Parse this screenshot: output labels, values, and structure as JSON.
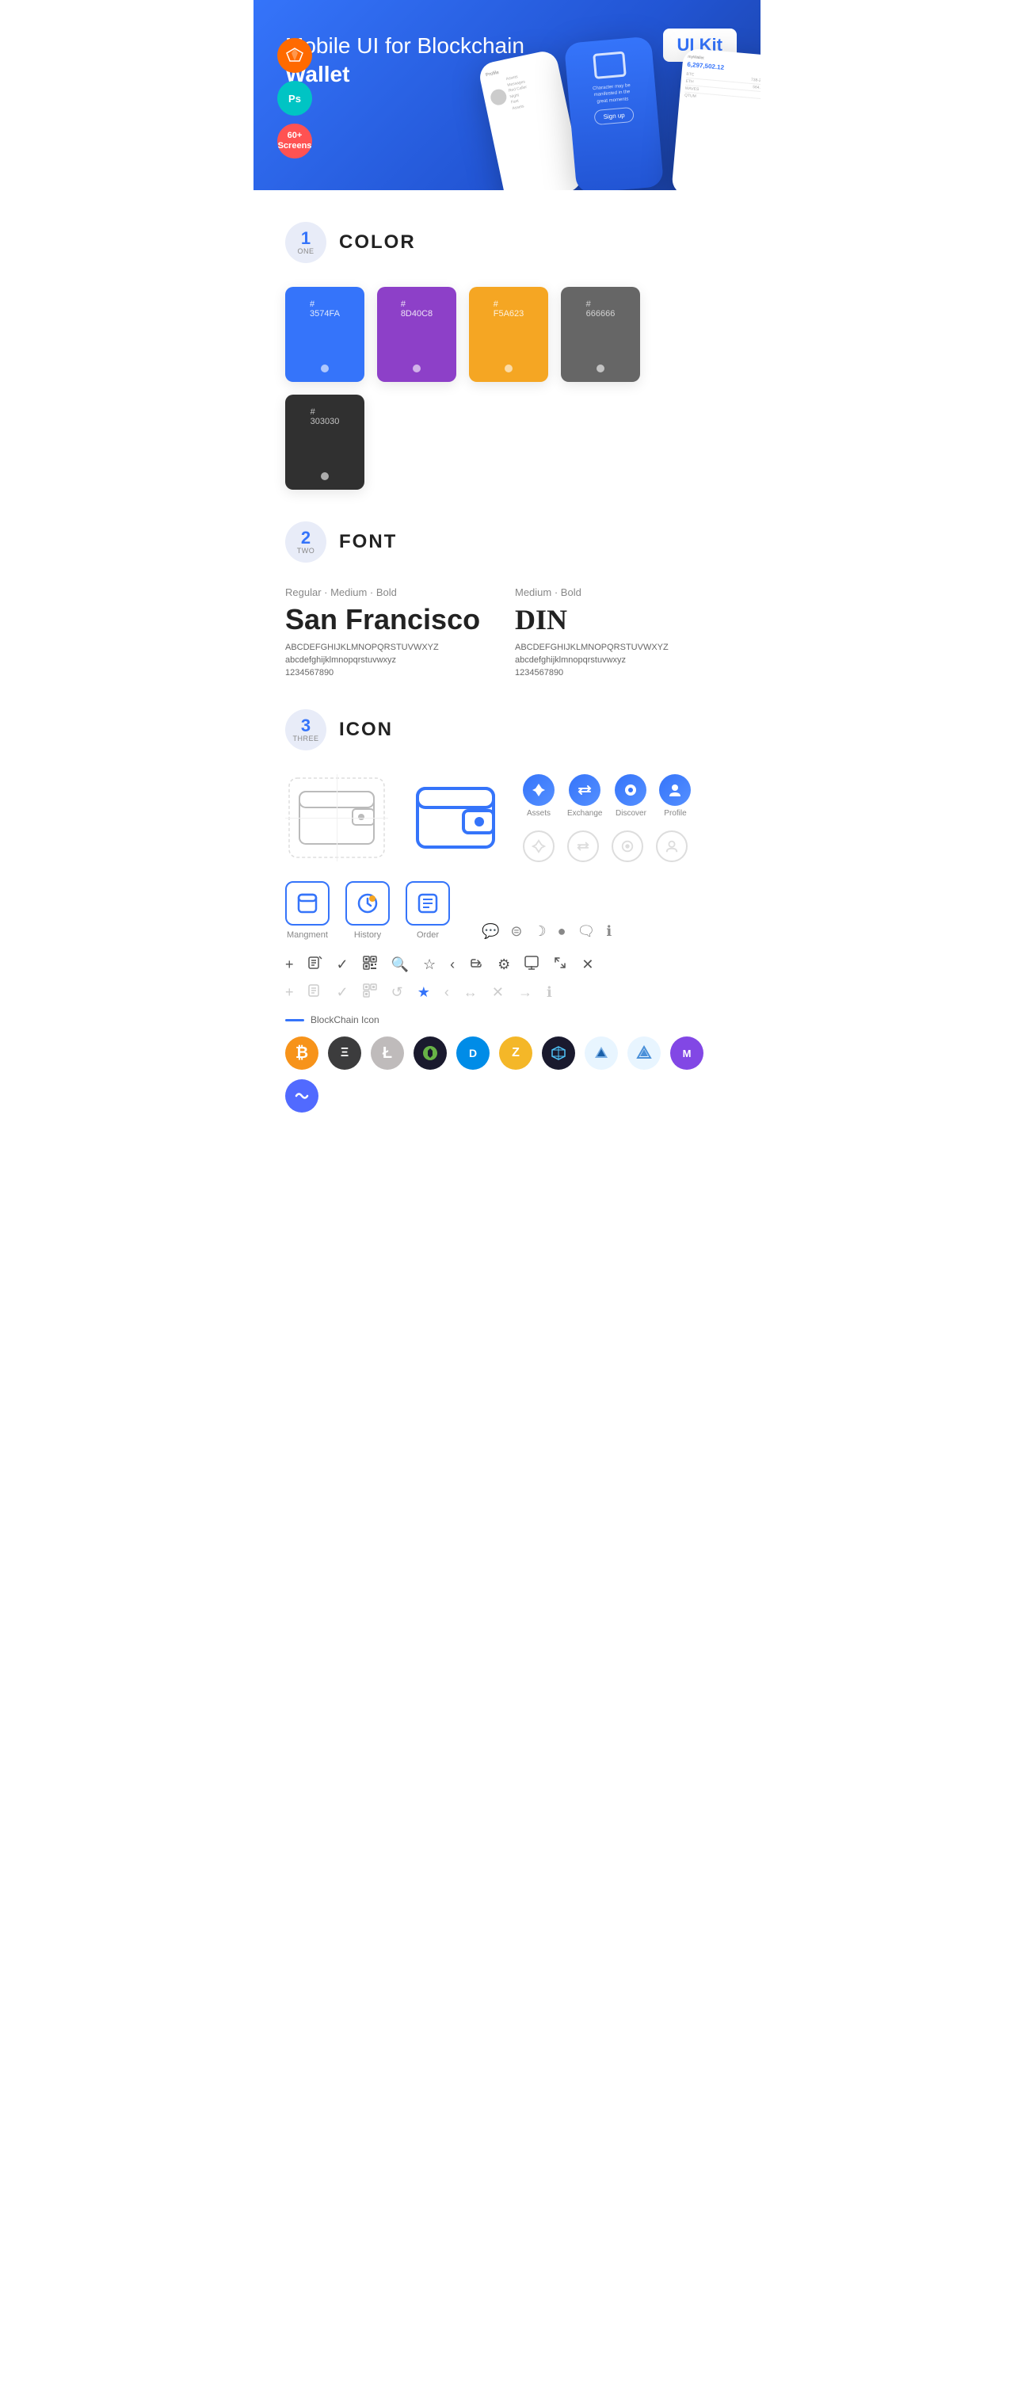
{
  "hero": {
    "title_normal": "Mobile UI for Blockchain ",
    "title_bold": "Wallet",
    "badge": "UI Kit",
    "badges": [
      {
        "id": "sketch",
        "label": "S"
      },
      {
        "id": "ps",
        "label": "Ps"
      },
      {
        "id": "screens",
        "line1": "60+",
        "line2": "Screens"
      }
    ],
    "phone_left_label": "Profile",
    "phone_center_amount": "6,297,502.12",
    "phone_right_label": "myWallet"
  },
  "sections": {
    "color": {
      "num": "1",
      "word": "ONE",
      "title": "COLOR",
      "swatches": [
        {
          "hex": "#3574FA",
          "label": "3574FA"
        },
        {
          "hex": "#8D40C8",
          "label": "8D40C8"
        },
        {
          "hex": "#F5A623",
          "label": "F5A623"
        },
        {
          "hex": "#666666",
          "label": "666666"
        },
        {
          "hex": "#303030",
          "label": "303030"
        }
      ]
    },
    "font": {
      "num": "2",
      "word": "TWO",
      "title": "FONT",
      "fonts": [
        {
          "style": "Regular · Medium · Bold",
          "name": "San Francisco",
          "uppercase": "ABCDEFGHIJKLMNOPQRSTUVWXYZ",
          "lowercase": "abcdefghijklmnopqrstuvwxyz",
          "numbers": "1234567890"
        },
        {
          "style": "Medium · Bold",
          "name": "DIN",
          "uppercase": "ABCDEFGHIJKLMNOPQRSTUVWXYZ",
          "lowercase": "abcdefghijklmnopqrstuvwxyz",
          "numbers": "1234567890"
        }
      ]
    },
    "icon": {
      "num": "3",
      "word": "THREE",
      "title": "ICON",
      "nav_icons": [
        {
          "label": "Assets",
          "symbol": "◆"
        },
        {
          "label": "Exchange",
          "symbol": "⇄"
        },
        {
          "label": "Discover",
          "symbol": "●"
        },
        {
          "label": "Profile",
          "symbol": "◑"
        }
      ],
      "nav_icons_outline": [
        {
          "label": "",
          "symbol": "◆"
        },
        {
          "label": "",
          "symbol": "⇄"
        },
        {
          "label": "",
          "symbol": "●"
        },
        {
          "label": "",
          "symbol": "◑"
        }
      ],
      "bottom_icons": [
        {
          "label": "Mangment",
          "symbol": "▭"
        },
        {
          "label": "History",
          "symbol": "◷"
        },
        {
          "label": "Order",
          "symbol": "≡"
        }
      ],
      "misc_icons_row1": [
        "✕",
        "≡",
        "✓",
        "⊞",
        "🔍",
        "☆",
        "‹",
        "‹‹",
        "⚙",
        "⬆",
        "⬌",
        "✕"
      ],
      "misc_icons_row2_gray": [
        "+",
        "≡",
        "✓",
        "⊞",
        "↺",
        "☆",
        "‹",
        "↔",
        "✕",
        "→",
        "ℹ"
      ],
      "blockchain_label": "BlockChain Icon",
      "crypto_coins": [
        {
          "id": "btc",
          "symbol": "₿",
          "class": "crypto-btc"
        },
        {
          "id": "eth",
          "symbol": "Ξ",
          "class": "crypto-eth"
        },
        {
          "id": "ltc",
          "symbol": "Ł",
          "class": "crypto-ltc"
        },
        {
          "id": "nem",
          "symbol": "✦",
          "class": "crypto-nem"
        },
        {
          "id": "dash",
          "symbol": "D",
          "class": "crypto-dash"
        },
        {
          "id": "zcash",
          "symbol": "Z",
          "class": "crypto-zcash"
        },
        {
          "id": "grid",
          "symbol": "⬡",
          "class": "crypto-grid"
        },
        {
          "id": "ark",
          "symbol": "▲",
          "class": "crypto-ark"
        },
        {
          "id": "steem",
          "symbol": "S",
          "class": "crypto-steem"
        },
        {
          "id": "matic",
          "symbol": "M",
          "class": "crypto-matic"
        },
        {
          "id": "band",
          "symbol": "~",
          "class": "crypto-band"
        }
      ]
    }
  }
}
